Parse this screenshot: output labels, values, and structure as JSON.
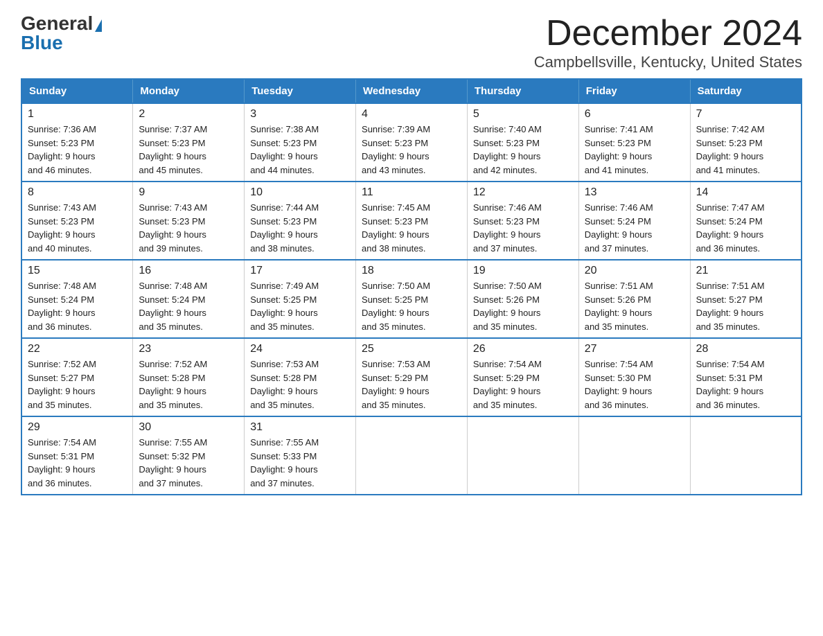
{
  "logo": {
    "general": "General",
    "blue": "Blue"
  },
  "title": "December 2024",
  "subtitle": "Campbellsville, Kentucky, United States",
  "days_of_week": [
    "Sunday",
    "Monday",
    "Tuesday",
    "Wednesday",
    "Thursday",
    "Friday",
    "Saturday"
  ],
  "weeks": [
    [
      {
        "day": "1",
        "sunrise": "7:36 AM",
        "sunset": "5:23 PM",
        "daylight": "9 hours and 46 minutes."
      },
      {
        "day": "2",
        "sunrise": "7:37 AM",
        "sunset": "5:23 PM",
        "daylight": "9 hours and 45 minutes."
      },
      {
        "day": "3",
        "sunrise": "7:38 AM",
        "sunset": "5:23 PM",
        "daylight": "9 hours and 44 minutes."
      },
      {
        "day": "4",
        "sunrise": "7:39 AM",
        "sunset": "5:23 PM",
        "daylight": "9 hours and 43 minutes."
      },
      {
        "day": "5",
        "sunrise": "7:40 AM",
        "sunset": "5:23 PM",
        "daylight": "9 hours and 42 minutes."
      },
      {
        "day": "6",
        "sunrise": "7:41 AM",
        "sunset": "5:23 PM",
        "daylight": "9 hours and 41 minutes."
      },
      {
        "day": "7",
        "sunrise": "7:42 AM",
        "sunset": "5:23 PM",
        "daylight": "9 hours and 41 minutes."
      }
    ],
    [
      {
        "day": "8",
        "sunrise": "7:43 AM",
        "sunset": "5:23 PM",
        "daylight": "9 hours and 40 minutes."
      },
      {
        "day": "9",
        "sunrise": "7:43 AM",
        "sunset": "5:23 PM",
        "daylight": "9 hours and 39 minutes."
      },
      {
        "day": "10",
        "sunrise": "7:44 AM",
        "sunset": "5:23 PM",
        "daylight": "9 hours and 38 minutes."
      },
      {
        "day": "11",
        "sunrise": "7:45 AM",
        "sunset": "5:23 PM",
        "daylight": "9 hours and 38 minutes."
      },
      {
        "day": "12",
        "sunrise": "7:46 AM",
        "sunset": "5:23 PM",
        "daylight": "9 hours and 37 minutes."
      },
      {
        "day": "13",
        "sunrise": "7:46 AM",
        "sunset": "5:24 PM",
        "daylight": "9 hours and 37 minutes."
      },
      {
        "day": "14",
        "sunrise": "7:47 AM",
        "sunset": "5:24 PM",
        "daylight": "9 hours and 36 minutes."
      }
    ],
    [
      {
        "day": "15",
        "sunrise": "7:48 AM",
        "sunset": "5:24 PM",
        "daylight": "9 hours and 36 minutes."
      },
      {
        "day": "16",
        "sunrise": "7:48 AM",
        "sunset": "5:24 PM",
        "daylight": "9 hours and 35 minutes."
      },
      {
        "day": "17",
        "sunrise": "7:49 AM",
        "sunset": "5:25 PM",
        "daylight": "9 hours and 35 minutes."
      },
      {
        "day": "18",
        "sunrise": "7:50 AM",
        "sunset": "5:25 PM",
        "daylight": "9 hours and 35 minutes."
      },
      {
        "day": "19",
        "sunrise": "7:50 AM",
        "sunset": "5:26 PM",
        "daylight": "9 hours and 35 minutes."
      },
      {
        "day": "20",
        "sunrise": "7:51 AM",
        "sunset": "5:26 PM",
        "daylight": "9 hours and 35 minutes."
      },
      {
        "day": "21",
        "sunrise": "7:51 AM",
        "sunset": "5:27 PM",
        "daylight": "9 hours and 35 minutes."
      }
    ],
    [
      {
        "day": "22",
        "sunrise": "7:52 AM",
        "sunset": "5:27 PM",
        "daylight": "9 hours and 35 minutes."
      },
      {
        "day": "23",
        "sunrise": "7:52 AM",
        "sunset": "5:28 PM",
        "daylight": "9 hours and 35 minutes."
      },
      {
        "day": "24",
        "sunrise": "7:53 AM",
        "sunset": "5:28 PM",
        "daylight": "9 hours and 35 minutes."
      },
      {
        "day": "25",
        "sunrise": "7:53 AM",
        "sunset": "5:29 PM",
        "daylight": "9 hours and 35 minutes."
      },
      {
        "day": "26",
        "sunrise": "7:54 AM",
        "sunset": "5:29 PM",
        "daylight": "9 hours and 35 minutes."
      },
      {
        "day": "27",
        "sunrise": "7:54 AM",
        "sunset": "5:30 PM",
        "daylight": "9 hours and 36 minutes."
      },
      {
        "day": "28",
        "sunrise": "7:54 AM",
        "sunset": "5:31 PM",
        "daylight": "9 hours and 36 minutes."
      }
    ],
    [
      {
        "day": "29",
        "sunrise": "7:54 AM",
        "sunset": "5:31 PM",
        "daylight": "9 hours and 36 minutes."
      },
      {
        "day": "30",
        "sunrise": "7:55 AM",
        "sunset": "5:32 PM",
        "daylight": "9 hours and 37 minutes."
      },
      {
        "day": "31",
        "sunrise": "7:55 AM",
        "sunset": "5:33 PM",
        "daylight": "9 hours and 37 minutes."
      },
      null,
      null,
      null,
      null
    ]
  ],
  "labels": {
    "sunrise": "Sunrise:",
    "sunset": "Sunset:",
    "daylight": "Daylight:"
  }
}
